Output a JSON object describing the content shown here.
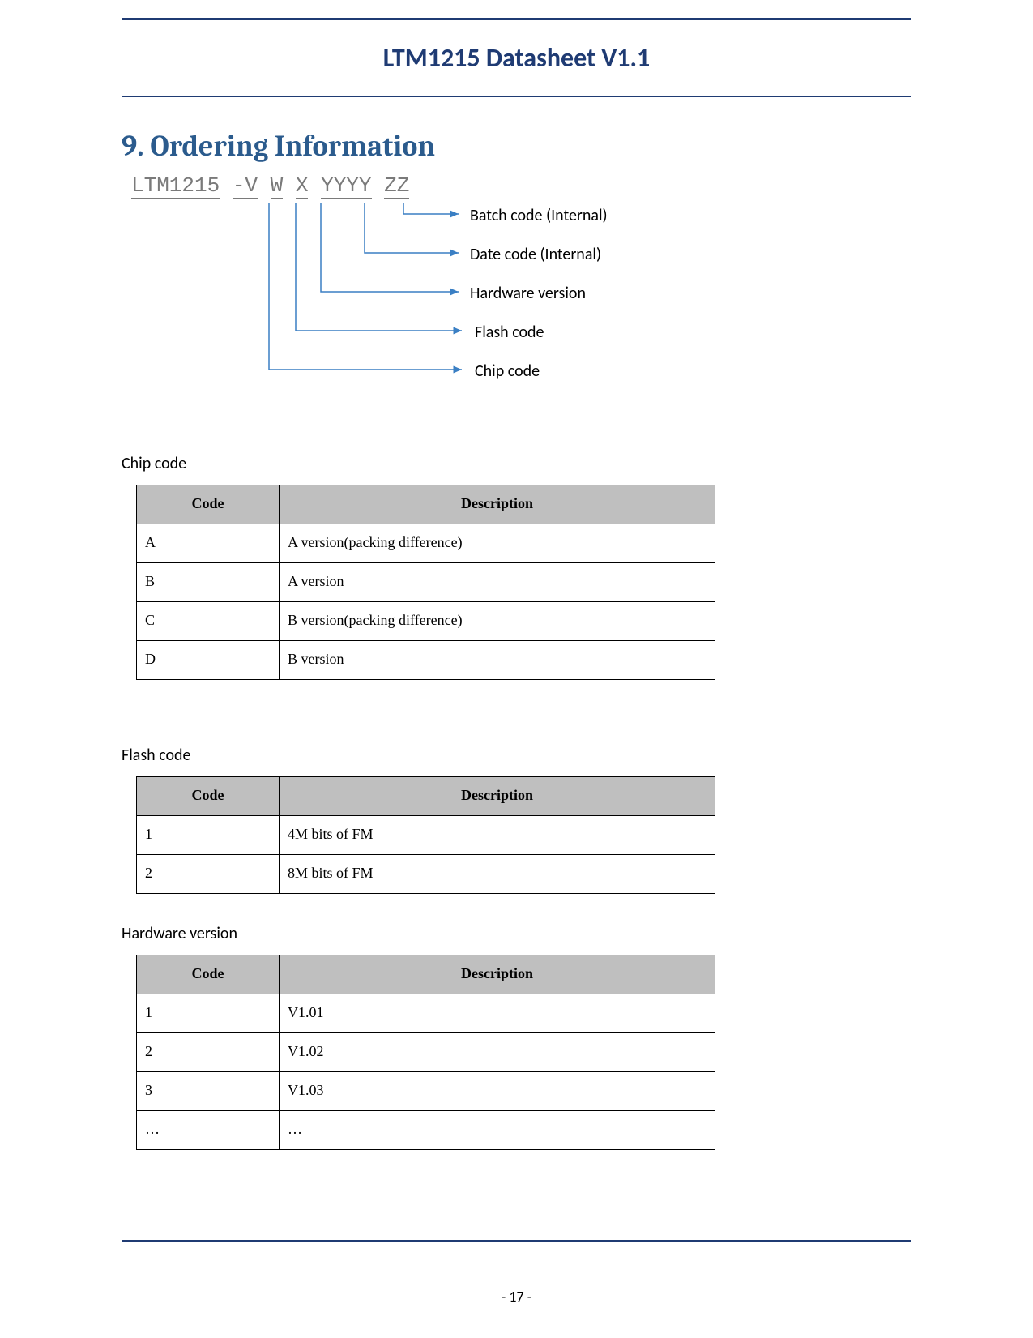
{
  "doc_title": "LTM1215 Datasheet V1.1",
  "section_heading": "9. Ordering Information",
  "part_number_parts": [
    "LTM1215",
    "-V",
    "W",
    "X",
    "YYYY",
    "ZZ"
  ],
  "callouts": {
    "batch": "Batch code (Internal)",
    "date": "Date code (Internal)",
    "hw": "Hardware version",
    "flash": "Flash code",
    "chip": "Chip code"
  },
  "tables": {
    "chip": {
      "heading": "Chip code",
      "columns": [
        "Code",
        "Description"
      ],
      "rows": [
        [
          "A",
          "A version(packing difference)"
        ],
        [
          "B",
          "A version"
        ],
        [
          "C",
          "B version(packing difference)"
        ],
        [
          "D",
          "B version"
        ]
      ]
    },
    "flash": {
      "heading": "Flash code",
      "columns": [
        "Code",
        "Description"
      ],
      "rows": [
        [
          "1",
          "4M bits of FM"
        ],
        [
          "2",
          "8M bits of FM"
        ]
      ]
    },
    "hw": {
      "heading": "Hardware version",
      "columns": [
        "Code",
        "Description"
      ],
      "rows": [
        [
          "1",
          "V1.01"
        ],
        [
          "2",
          "V1.02"
        ],
        [
          "3",
          "V1.03"
        ],
        [
          "…",
          "…"
        ]
      ]
    }
  },
  "page_number": "- 17 -"
}
